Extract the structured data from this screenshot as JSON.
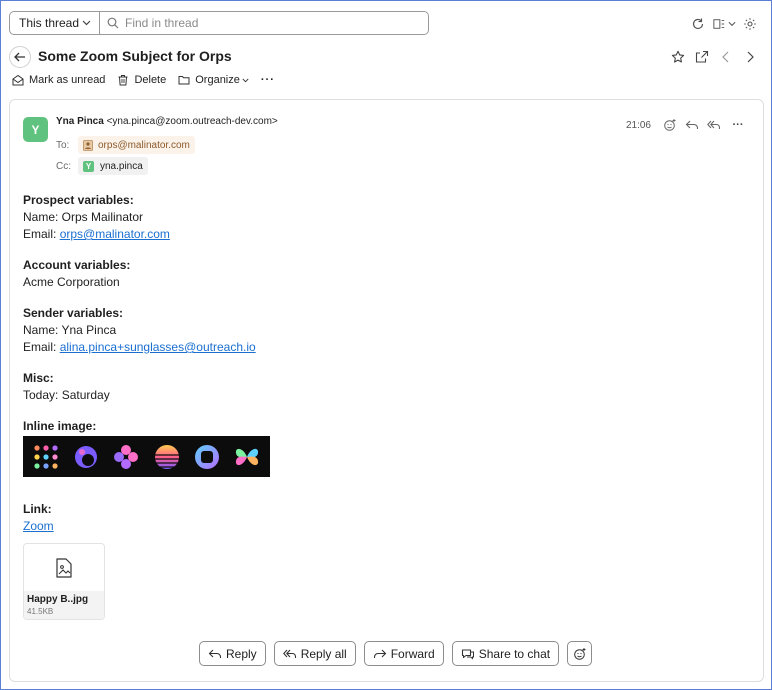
{
  "search": {
    "scope_label": "This thread",
    "placeholder": "Find in thread"
  },
  "thread": {
    "subject": "Some Zoom Subject for Orps"
  },
  "actions": {
    "mark_unread": "Mark as unread",
    "delete": "Delete",
    "organize": "Organize",
    "more": "···"
  },
  "message": {
    "avatar_letter": "Y",
    "sender_name": "Yna Pinca",
    "sender_email": "<yna.pinca@zoom.outreach-dev.com>",
    "time": "21:06",
    "to_label": "To:",
    "to_address": "orps@malinator.com",
    "cc_label": "Cc:",
    "cc_avatar_letter": "Y",
    "cc_name": "yna.pinca",
    "more": "···"
  },
  "body": {
    "prospect_heading": "Prospect variables:",
    "prospect_name": "Name: Orps Mailinator",
    "prospect_email_label": "Email: ",
    "prospect_email": "orps@malinator.com",
    "account_heading": "Account variables:",
    "account_name": "Acme Corporation",
    "sender_heading": "Sender variables:",
    "sender_name": "Name: Yna Pinca",
    "sender_email_label": "Email: ",
    "sender_email": "alina.pinca+sunglasses@outreach.io",
    "misc_heading": "Misc:",
    "misc_today": "Today: Saturday",
    "inline_heading": "Inline image:",
    "link_heading": "Link:",
    "link_text": "Zoom"
  },
  "attachment": {
    "name": "Happy B..jpg",
    "size": "41.5KB"
  },
  "reply_bar": {
    "reply": "Reply",
    "reply_all": "Reply all",
    "forward": "Forward",
    "share": "Share to chat"
  },
  "colors": {
    "accent": "#1a6fd1",
    "avatar": "#5fc27e",
    "frame": "#5b7fd6"
  }
}
